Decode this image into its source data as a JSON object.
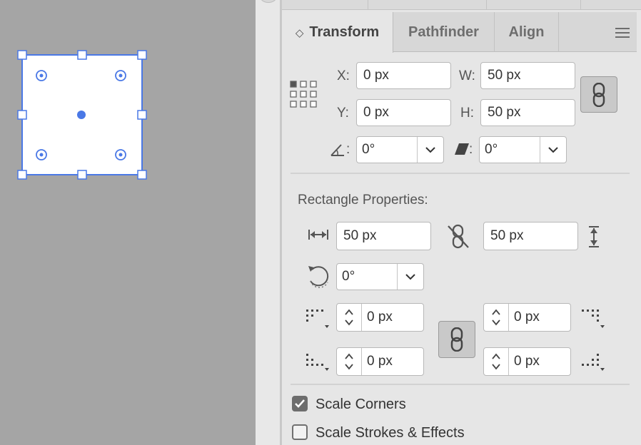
{
  "canvas": {
    "selection_color": "#4a78e6"
  },
  "panel": {
    "tabs": [
      {
        "label": "Transform",
        "active": true
      },
      {
        "label": "Pathfinder",
        "active": false
      },
      {
        "label": "Align",
        "active": false
      }
    ],
    "transform": {
      "x_label": "X:",
      "x_value": "0 px",
      "y_label": "Y:",
      "y_value": "0 px",
      "w_label": "W:",
      "w_value": "50 px",
      "h_label": "H:",
      "h_value": "50 px",
      "rotate_label": ":",
      "rotate_value": "0°",
      "shear_label": ":",
      "shear_value": "0°"
    },
    "rect_props": {
      "title": "Rectangle Properties:",
      "width_value": "50 px",
      "height_value": "50 px",
      "corner_rotate_value": "0°",
      "corner_tl": "0 px",
      "corner_tr": "0 px",
      "corner_bl": "0 px",
      "corner_br": "0 px"
    },
    "options": {
      "scale_corners_label": "Scale Corners",
      "scale_corners_checked": true,
      "scale_strokes_label": "Scale Strokes & Effects",
      "scale_strokes_checked": false
    }
  }
}
